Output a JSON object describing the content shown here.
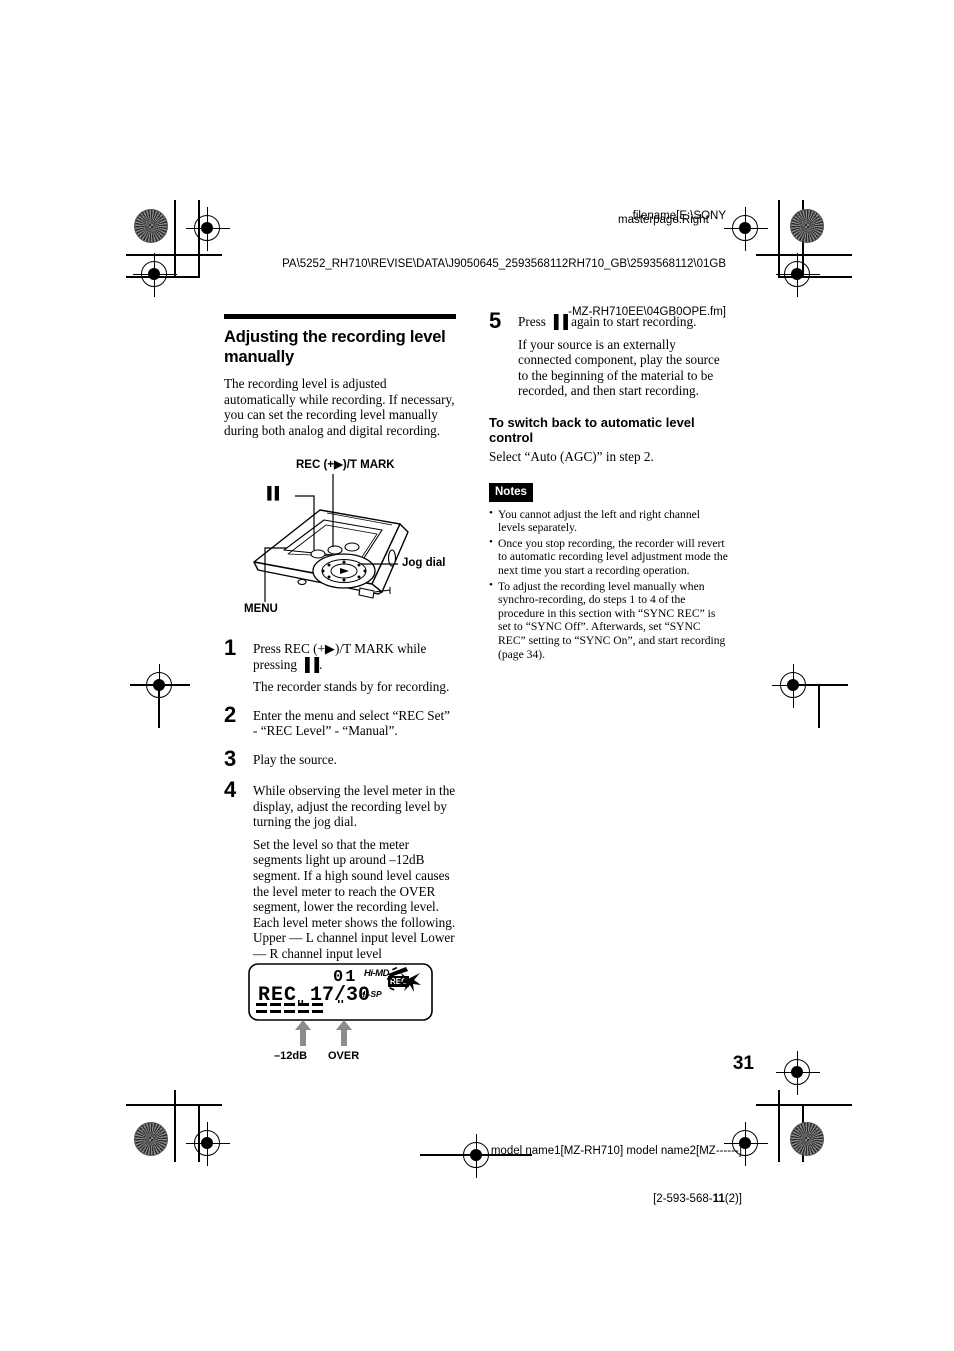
{
  "job": {
    "header_line1": "filename[E:\\SONY",
    "header_line2": "PA\\5252_RH710\\REVISE\\DATA\\J9050645_2593568112RH710_GB\\2593568112\\01GB",
    "header_line3": "-MZ-RH710EE\\04GB0OPE.fm]",
    "masterpage": "masterpage:Right",
    "footer_model": "model name1[MZ-RH710] model name2[MZ------]",
    "footer_code_prefix": "[2-593-568-",
    "footer_code_bold": "11",
    "footer_code_suffix": "(2)]"
  },
  "page_number": "31",
  "left_column": {
    "title": "Adjusting the recording level manually",
    "intro": "The recording level is adjusted automatically while recording. If necessary, you can set the recording level manually during both analog and digital recording.",
    "figure_device": {
      "label_rec": "REC (+▶)/T MARK",
      "label_pause": "▐▐",
      "label_jog": "Jog dial",
      "label_menu": "MENU"
    },
    "steps": [
      {
        "num": "1",
        "paragraphs": [
          "Press REC (+▶)/T MARK while pressing ▐▐.",
          "The recorder stands by for recording."
        ]
      },
      {
        "num": "2",
        "paragraphs": [
          "Enter the menu and select “REC Set” - “REC Level” - “Manual”."
        ]
      },
      {
        "num": "3",
        "paragraphs": [
          "Play the source."
        ]
      },
      {
        "num": "4",
        "paragraphs": [
          "While observing the level meter in the display, adjust the recording level by turning the jog dial.",
          "Set the level so that the meter segments light up around –12dB segment. If a high sound level causes the level meter to reach the OVER segment, lower the recording level. Each level meter shows the following. Upper — L channel input level Lower — R channel input level"
        ]
      }
    ],
    "figure_lcd": {
      "rec_text": "REC",
      "track_number": "01",
      "track_counter": "17/30",
      "badge_himd": "Hi-MD",
      "badge_hisp": "HI-SP",
      "badge_rec": "REC",
      "caption_left": "–12dB",
      "caption_right": "OVER"
    }
  },
  "right_column": {
    "step5": {
      "num": "5",
      "paragraphs": [
        "Press ▐▐ again to start recording.",
        "If your source is an externally connected component, play the source to the beginning of the material to be recorded, and then start recording."
      ]
    },
    "subsection": {
      "title": "To switch back to automatic level control",
      "body": "Select “Auto (AGC)” in step 2."
    },
    "notes_label": "Notes",
    "notes": [
      "You cannot adjust the left and right channel levels separately.",
      "Once you stop recording, the recorder will revert to automatic recording level adjustment mode the next time you start a recording operation.",
      "To adjust the recording level manually when synchro-recording, do steps 1 to 4 of the procedure in this section with “SYNC REC” is set to “SYNC Off”. Afterwards, set “SYNC REC” setting to “SYNC On”, and start recording (page 34)."
    ]
  }
}
